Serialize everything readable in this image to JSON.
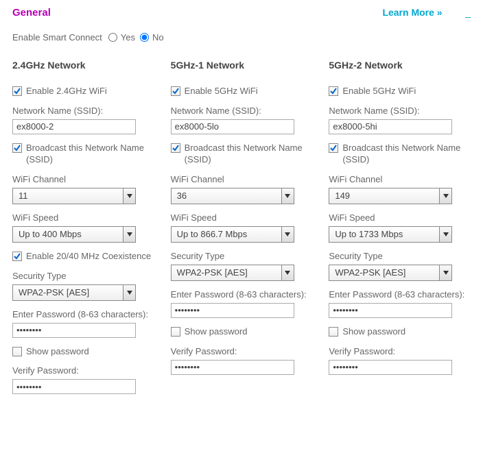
{
  "header": {
    "title": "General",
    "learn_more": "Learn More »",
    "dash": "—"
  },
  "smart_connect": {
    "label": "Enable Smart Connect",
    "yes": "Yes",
    "no": "No",
    "selected": "No"
  },
  "labels": {
    "ssid": "Network Name (SSID):",
    "broadcast": "Broadcast this Network Name (SSID)",
    "channel": "WiFi Channel",
    "speed": "WiFi Speed",
    "coexist": "Enable 20/40 MHz Coexistence",
    "sectype": "Security Type",
    "password": "Enter Password (8-63 characters):",
    "showpw": "Show password",
    "verify": "Verify Password:"
  },
  "bands": {
    "b24": {
      "title": "2.4GHz Network",
      "enable_label": "Enable 2.4GHz WiFi",
      "enable_checked": true,
      "ssid": "ex8000-2",
      "broadcast_checked": true,
      "channel": "11",
      "speed": "Up to 400 Mbps",
      "coexist_checked": true,
      "sectype": "WPA2-PSK [AES]",
      "password": "••••••••",
      "showpw_checked": false,
      "verify": "••••••••"
    },
    "b5a": {
      "title": "5GHz-1 Network",
      "enable_label": "Enable 5GHz WiFi",
      "enable_checked": true,
      "ssid": "ex8000-5lo",
      "broadcast_checked": true,
      "channel": "36",
      "speed": "Up to 866.7 Mbps",
      "sectype": "WPA2-PSK [AES]",
      "password": "••••••••",
      "showpw_checked": false,
      "verify": "••••••••"
    },
    "b5b": {
      "title": "5GHz-2 Network",
      "enable_label": "Enable 5GHz WiFi",
      "enable_checked": true,
      "ssid": "ex8000-5hi",
      "broadcast_checked": true,
      "channel": "149",
      "speed": "Up to 1733 Mbps",
      "sectype": "WPA2-PSK [AES]",
      "password": "••••••••",
      "showpw_checked": false,
      "verify": "••••••••"
    }
  }
}
